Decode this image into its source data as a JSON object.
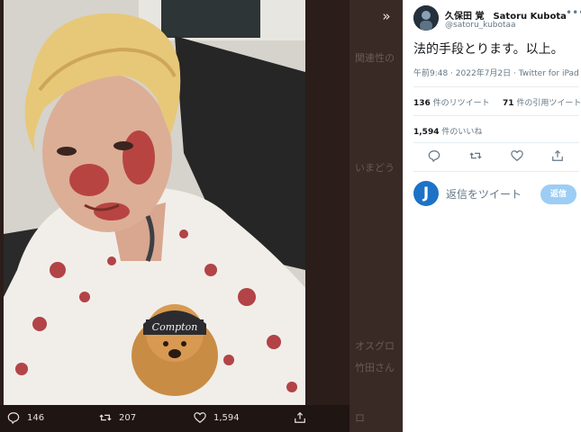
{
  "viewer": {
    "expand_icon": "chevron-double-right-icon",
    "backdrop_lines": [
      "関連性の",
      "いまどう",
      "オスグロ",
      "竹田さん",
      "ロ"
    ],
    "actions": {
      "reply_count": "146",
      "retweet_count": "207",
      "like_count": "1,594"
    }
  },
  "tweet": {
    "display_name": "久保田 覚　Satoru Kubota",
    "handle": "@satoru_kubotaa",
    "text": "法的手段とります。以上。",
    "meta": "午前9:48 · 2022年7月2日 · Twitter for iPad",
    "retweets": {
      "count": "136",
      "label": " 件のリツイート"
    },
    "quotes": {
      "count": "71",
      "label": " 件の引用ツイート"
    },
    "likes": {
      "count": "1,594",
      "label": " 件のいいね"
    },
    "reply_avatar_letter": "J",
    "reply_placeholder": "返信をツイート",
    "reply_button": "返信"
  },
  "colors": {
    "accent": "#1da1f2",
    "reply_button_disabled": "#9ccdf4",
    "viewer_bg": "#2b1d19"
  }
}
